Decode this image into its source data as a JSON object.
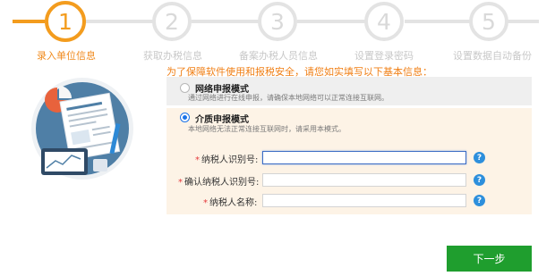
{
  "stepper": {
    "steps": [
      {
        "number": "1",
        "label": "录入单位信息",
        "active": true
      },
      {
        "number": "2",
        "label": "获取办税信息",
        "active": false
      },
      {
        "number": "3",
        "label": "备案办税人员信息",
        "active": false
      },
      {
        "number": "4",
        "label": "设置登录密码",
        "active": false
      },
      {
        "number": "5",
        "label": "设置数据自动备份",
        "active": false
      }
    ],
    "accent_color": "#f39c1e"
  },
  "instruction": "为了保障软件使用和报税安全，请您如实填写以下基本信息：",
  "options": [
    {
      "title": "网络申报模式",
      "description": "通过网络进行在线申报，请确保本地网络可以正常连接互联网。",
      "selected": false
    },
    {
      "title": "介质申报模式",
      "description": "本地网络无法正常连接互联网时，请采用本模式。",
      "selected": true
    }
  ],
  "form": {
    "fields": [
      {
        "required_mark": "*",
        "label": "纳税人识别号:",
        "value": "",
        "help": "?"
      },
      {
        "required_mark": "*",
        "label": "确认纳税人识别号:",
        "value": "",
        "help": "?"
      },
      {
        "required_mark": "*",
        "label": "纳税人名称:",
        "value": "",
        "help": "?"
      }
    ]
  },
  "next_button": "下一步",
  "icons": [
    "document-illustration-icon",
    "help-icon"
  ]
}
